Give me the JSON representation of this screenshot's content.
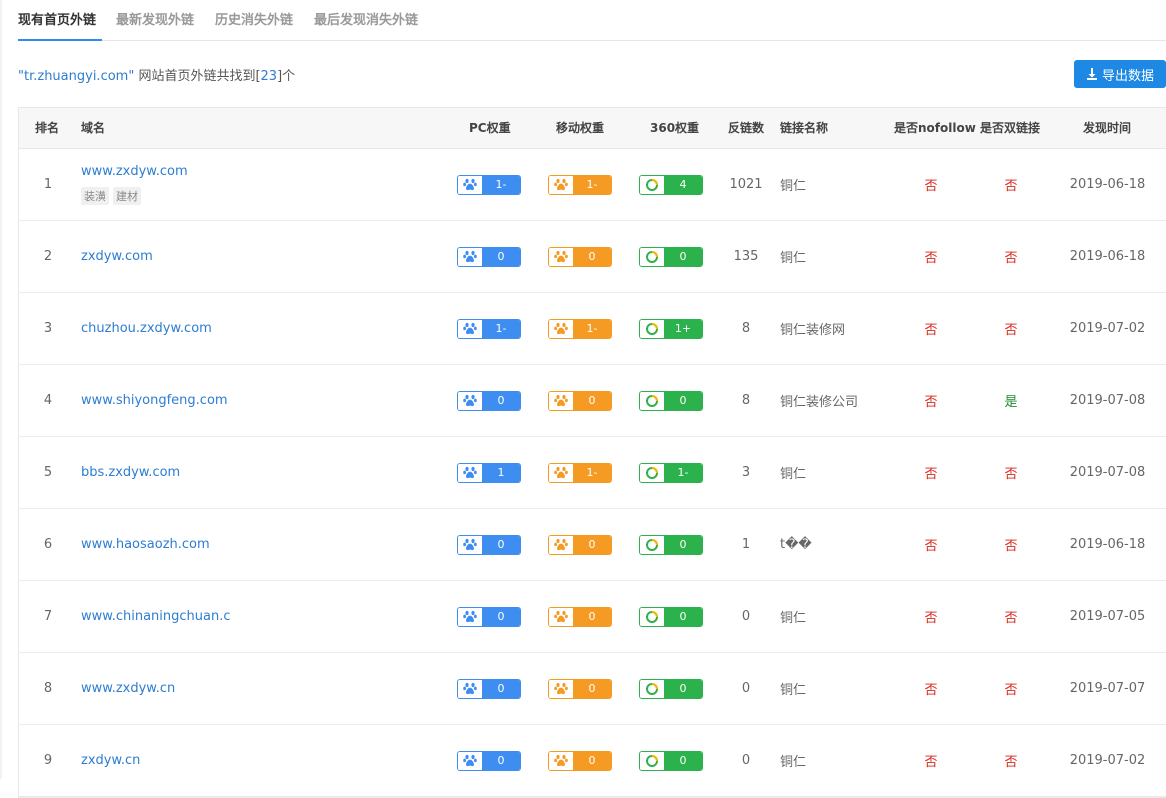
{
  "tabs": [
    {
      "label": "现有首页外链",
      "active": true
    },
    {
      "label": "最新发现外链",
      "active": false
    },
    {
      "label": "历史消失外链",
      "active": false
    },
    {
      "label": "最后发现消失外链",
      "active": false
    }
  ],
  "summary": {
    "quote_open": "\"",
    "site": "tr.zhuangyi.com",
    "quote_close": "\"",
    "text": " 网站首页外链共找到[",
    "count": "23",
    "text_end": "]个"
  },
  "export_label": "导出数据",
  "colors": {
    "pc": "#3d8ef0",
    "mobile": "#f59a23",
    "s360": "#2bb24c",
    "no": "#d9251c",
    "yes": "#1a8a2e",
    "link": "#2d7dd2"
  },
  "table": {
    "headers": {
      "rank": "排名",
      "domain": "域名",
      "pc": "PC权重",
      "mobile": "移动权重",
      "s360": "360权重",
      "backlinks": "反链数",
      "link_name": "链接名称",
      "nofollow": "是否nofollow",
      "double": "是否双链接",
      "date": "发现时间"
    },
    "rows": [
      {
        "rank": "1",
        "domain": "www.zxdyw.com",
        "tags": [
          "装潢",
          "建材"
        ],
        "pc": "1-",
        "mobile": "1-",
        "s360": "4",
        "backlinks": "1021",
        "link_name": "铜仁",
        "nofollow": "否",
        "double": "否",
        "date": "2019-06-18"
      },
      {
        "rank": "2",
        "domain": "zxdyw.com",
        "tags": [],
        "pc": "0",
        "mobile": "0",
        "s360": "0",
        "backlinks": "135",
        "link_name": "铜仁",
        "nofollow": "否",
        "double": "否",
        "date": "2019-06-18"
      },
      {
        "rank": "3",
        "domain": "chuzhou.zxdyw.com",
        "tags": [],
        "pc": "1-",
        "mobile": "1-",
        "s360": "1+",
        "backlinks": "8",
        "link_name": "铜仁装修网",
        "nofollow": "否",
        "double": "否",
        "date": "2019-07-02"
      },
      {
        "rank": "4",
        "domain": "www.shiyongfeng.com",
        "tags": [],
        "pc": "0",
        "mobile": "0",
        "s360": "0",
        "backlinks": "8",
        "link_name": "铜仁装修公司",
        "nofollow": "否",
        "double": "是",
        "date": "2019-07-08"
      },
      {
        "rank": "5",
        "domain": "bbs.zxdyw.com",
        "tags": [],
        "pc": "1",
        "mobile": "1-",
        "s360": "1-",
        "backlinks": "3",
        "link_name": "铜仁",
        "nofollow": "否",
        "double": "否",
        "date": "2019-07-08"
      },
      {
        "rank": "6",
        "domain": "www.haosaozh.com",
        "tags": [],
        "pc": "0",
        "mobile": "0",
        "s360": "0",
        "backlinks": "1",
        "link_name": "t��",
        "nofollow": "否",
        "double": "否",
        "date": "2019-06-18"
      },
      {
        "rank": "7",
        "domain": "www.chinaningchuan.c",
        "tags": [],
        "pc": "0",
        "mobile": "0",
        "s360": "0",
        "backlinks": "0",
        "link_name": "铜仁",
        "nofollow": "否",
        "double": "否",
        "date": "2019-07-05"
      },
      {
        "rank": "8",
        "domain": "www.zxdyw.cn",
        "tags": [],
        "pc": "0",
        "mobile": "0",
        "s360": "0",
        "backlinks": "0",
        "link_name": "铜仁",
        "nofollow": "否",
        "double": "否",
        "date": "2019-07-07"
      },
      {
        "rank": "9",
        "domain": "zxdyw.cn",
        "tags": [],
        "pc": "0",
        "mobile": "0",
        "s360": "0",
        "backlinks": "0",
        "link_name": "铜仁",
        "nofollow": "否",
        "double": "否",
        "date": "2019-07-02"
      }
    ]
  }
}
